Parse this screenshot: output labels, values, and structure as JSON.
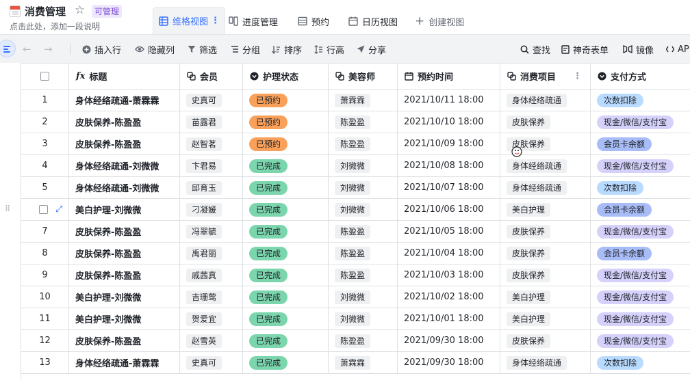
{
  "app": {
    "title": "消费管理",
    "permission_badge": "可管理",
    "description": "点击此处，添加一段说明"
  },
  "views": [
    {
      "label": "维格视图",
      "icon": "grid-view-icon",
      "active": true
    },
    {
      "label": "进度管理",
      "icon": "kanban-icon",
      "active": false
    },
    {
      "label": "预约",
      "icon": "gallery-icon",
      "active": false
    },
    {
      "label": "日历视图",
      "icon": "calendar-icon",
      "active": false
    },
    {
      "label": "创建视图",
      "icon": "plus-icon",
      "active": false
    }
  ],
  "toolbar": {
    "insert_row": "插入行",
    "hide_columns": "隐藏列",
    "filter": "筛选",
    "group": "分组",
    "sort": "排序",
    "row_height": "行高",
    "share": "分享",
    "find": "查找",
    "magic_form": "神奇表单",
    "mirror": "镜像",
    "api": "AP"
  },
  "columns": [
    {
      "key": "title",
      "label": "标题",
      "icon": "formula-icon"
    },
    {
      "key": "member",
      "label": "会员",
      "icon": "link-icon"
    },
    {
      "key": "status",
      "label": "护理状态",
      "icon": "single-select-icon"
    },
    {
      "key": "beautician",
      "label": "美容师",
      "icon": "link-icon"
    },
    {
      "key": "time",
      "label": "预约时间",
      "icon": "datetime-icon"
    },
    {
      "key": "item",
      "label": "消费项目",
      "icon": "link-icon"
    },
    {
      "key": "payment",
      "label": "支付方式",
      "icon": "single-select-icon"
    }
  ],
  "status_colors": {
    "已预约": "#f9a05a",
    "已完成": "#7bd5ad"
  },
  "payment_colors": {
    "次数扣除": "#b9dbff",
    "现金/微信/支付宝": "#d5d1fb",
    "会员卡余额": "#a8bcf7"
  },
  "rows": [
    {
      "num": "1",
      "title": "身体经络疏通-萧霖霖",
      "member": "史真可",
      "status": "已预约",
      "beautician": "萧霖霖",
      "time": "2021/10/11 18:00",
      "item": "身体经络疏通",
      "payment": "次数扣除"
    },
    {
      "num": "2",
      "title": "皮肤保养-陈盈盈",
      "member": "苗露君",
      "status": "已预约",
      "beautician": "陈盈盈",
      "time": "2021/10/10 18:00",
      "item": "皮肤保养",
      "payment": "现金/微信/支付宝"
    },
    {
      "num": "3",
      "title": "皮肤保养-陈盈盈",
      "member": "赵智茗",
      "status": "已预约",
      "beautician": "陈盈盈",
      "time": "2021/10/09 18:00",
      "item": "皮肤保养",
      "payment": "会员卡余额"
    },
    {
      "num": "4",
      "title": "身体经络疏通-刘微微",
      "member": "卞君易",
      "status": "已完成",
      "beautician": "刘微微",
      "time": "2021/10/08 18:00",
      "item": "身体经络疏通",
      "payment": "现金/微信/支付宝"
    },
    {
      "num": "5",
      "title": "身体经络疏通-刘微微",
      "member": "邱育玉",
      "status": "已完成",
      "beautician": "刘微微",
      "time": "2021/10/07 18:00",
      "item": "身体经络疏通",
      "payment": "次数扣除"
    },
    {
      "num": "",
      "title": "美白护理-刘微微",
      "member": "刁凝媛",
      "status": "已完成",
      "beautician": "刘微微",
      "time": "2021/10/06 18:00",
      "item": "美白护理",
      "payment": "会员卡余额"
    },
    {
      "num": "7",
      "title": "皮肤保养-陈盈盈",
      "member": "冯翠毓",
      "status": "已完成",
      "beautician": "陈盈盈",
      "time": "2021/10/05 18:00",
      "item": "皮肤保养",
      "payment": "现金/微信/支付宝"
    },
    {
      "num": "8",
      "title": "皮肤保养-陈盈盈",
      "member": "禹君丽",
      "status": "已完成",
      "beautician": "陈盈盈",
      "time": "2021/10/04 18:00",
      "item": "皮肤保养",
      "payment": "会员卡余额"
    },
    {
      "num": "9",
      "title": "皮肤保养-陈盈盈",
      "member": "戚茜真",
      "status": "已完成",
      "beautician": "陈盈盈",
      "time": "2021/10/03 18:00",
      "item": "皮肤保养",
      "payment": "现金/微信/支付宝"
    },
    {
      "num": "10",
      "title": "美白护理-刘微微",
      "member": "吉珊莺",
      "status": "已完成",
      "beautician": "刘微微",
      "time": "2021/10/02 18:00",
      "item": "美白护理",
      "payment": "现金/微信/支付宝"
    },
    {
      "num": "11",
      "title": "美白护理-刘微微",
      "member": "贺爱宜",
      "status": "已完成",
      "beautician": "刘微微",
      "time": "2021/10/01 18:00",
      "item": "美白护理",
      "payment": "现金/微信/支付宝"
    },
    {
      "num": "12",
      "title": "皮肤保养-陈盈盈",
      "member": "赵雪英",
      "status": "已完成",
      "beautician": "陈盈盈",
      "time": "2021/09/30 18:00",
      "item": "皮肤保养",
      "payment": "现金/微信/支付宝"
    },
    {
      "num": "13",
      "title": "身体经络疏通-萧霖霖",
      "member": "史真可",
      "status": "已完成",
      "beautician": "萧霖霖",
      "time": "2021/09/30 18:00",
      "item": "身体经络疏通",
      "payment": "次数扣除"
    }
  ]
}
